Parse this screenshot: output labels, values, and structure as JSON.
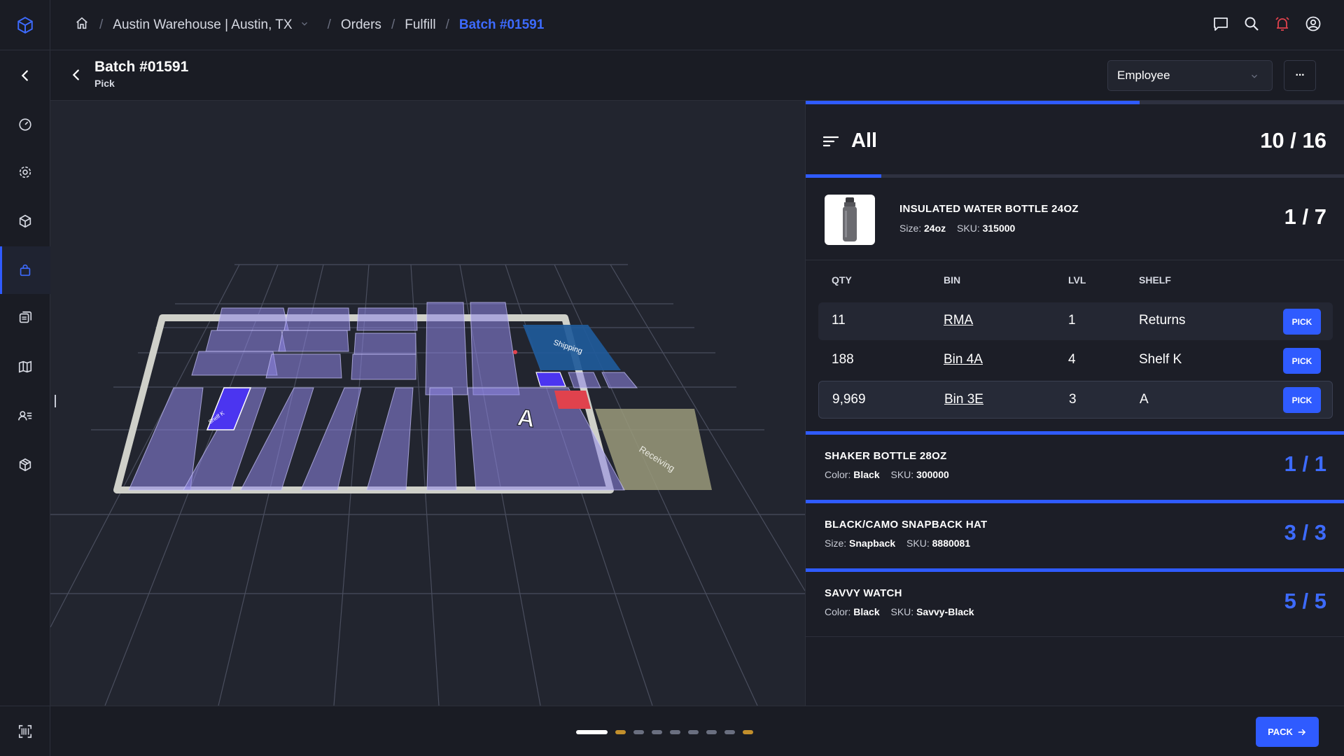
{
  "breadcrumbs": {
    "warehouse": "Austin Warehouse | Austin, TX",
    "orders": "Orders",
    "fulfill": "Fulfill",
    "batch": "Batch #01591",
    "sep": "/"
  },
  "header": {
    "title": "Batch #01591",
    "subtitle": "Pick",
    "employee_select": "Employee",
    "more": "···"
  },
  "sidebar": {
    "items": [
      "dashboard-icon",
      "gear-icon",
      "box-icon",
      "bag-icon",
      "transfer-icon",
      "map-icon",
      "users-icon",
      "package-icon"
    ],
    "active": "bag-icon"
  },
  "map": {
    "labels": {
      "shipping": "Shipping",
      "receiving": "Receiving",
      "shelf": "Shelf K",
      "marker": "A"
    }
  },
  "panel": {
    "filter_label": "All",
    "overall_count": "10 / 16",
    "overall_progress": 0.62,
    "current_item": {
      "name": "INSULATED WATER BOTTLE 24OZ",
      "meta_key1": "Size:",
      "meta_val1": "24oz",
      "meta_key2": "SKU:",
      "meta_val2": "315000",
      "count": "1 / 7",
      "progress": 0.14
    },
    "columns": {
      "qty": "QTY",
      "bin": "BIN",
      "lvl": "LVL",
      "shelf": "SHELF"
    },
    "rows": [
      {
        "qty": "11",
        "bin": "RMA",
        "lvl": "1",
        "shelf": "Returns",
        "action": "PICK"
      },
      {
        "qty": "188",
        "bin": "Bin 4A",
        "lvl": "4",
        "shelf": "Shelf K",
        "action": "PICK"
      },
      {
        "qty": "9,969",
        "bin": "Bin 3E",
        "lvl": "3",
        "shelf": "A",
        "action": "PICK"
      }
    ],
    "completed_items": [
      {
        "name": "SHAKER BOTTLE 28OZ",
        "key1": "Color:",
        "val1": "Black",
        "key2": "SKU:",
        "val2": "300000",
        "count": "1 / 1"
      },
      {
        "name": "BLACK/CAMO SNAPBACK HAT",
        "key1": "Size:",
        "val1": "Snapback",
        "key2": "SKU:",
        "val2": "8880081",
        "count": "3 / 3"
      },
      {
        "name": "SAVVY WATCH",
        "key1": "Color:",
        "val1": "Black",
        "key2": "SKU:",
        "val2": "Savvy-Black",
        "count": "5 / 5"
      }
    ]
  },
  "footer": {
    "pack_label": "PACK",
    "pager_count": 10,
    "pager_active": 0
  },
  "colors": {
    "accent": "#2f5bff",
    "alert": "#e0424d",
    "shelf": "#8f87e6",
    "receiving": "#9a9a7a",
    "shipping": "#1f5a9a"
  }
}
